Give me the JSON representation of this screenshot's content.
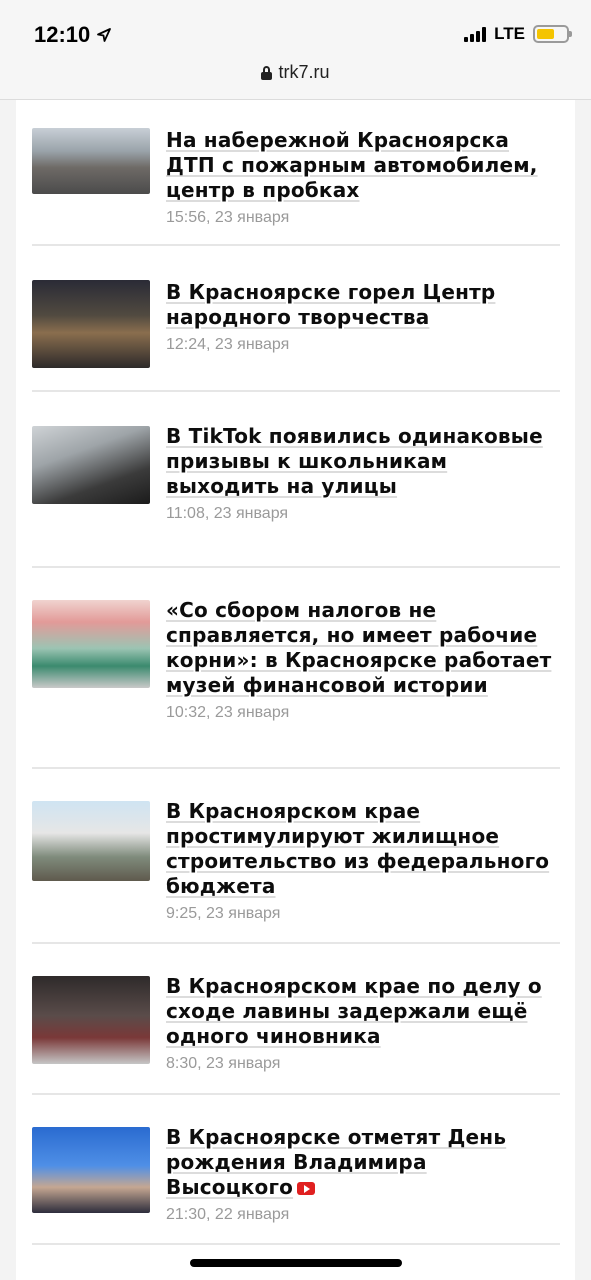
{
  "status": {
    "time": "12:10",
    "network": "LTE",
    "battery_level": 0.6
  },
  "browser": {
    "url": "trk7.ru"
  },
  "articles": [
    {
      "title": "На набережной Красноярска ДТП с пожарным автомобилем, центр в пробках",
      "timestamp": "15:56, 23 января"
    },
    {
      "title": "В Красноярске горел Центр народного творчества",
      "timestamp": "12:24, 23 января"
    },
    {
      "title": "В TikTok появились одинаковые призывы к школьникам выходить на улицы",
      "timestamp": "11:08, 23 января"
    },
    {
      "title": "«Со сбором налогов не справляется, но имеет рабочие корни»: в Красноярске работает музей финансовой истории",
      "timestamp": "10:32, 23 января"
    },
    {
      "title": "В Красноярском крае простимулируют жилищное строительство из федерального бюджета",
      "timestamp": "9:25, 23 января"
    },
    {
      "title": "В Красноярском крае по делу о сходе лавины задержали ещё одного чиновника",
      "timestamp": "8:30, 23 января"
    },
    {
      "title": "В Красноярске отметят День рождения Владимира Высоцкого",
      "timestamp": "21:30, 22 января",
      "has_video": true
    }
  ],
  "colors": {
    "accent_video": "#e02020",
    "timestamp": "#9a9a9a"
  }
}
